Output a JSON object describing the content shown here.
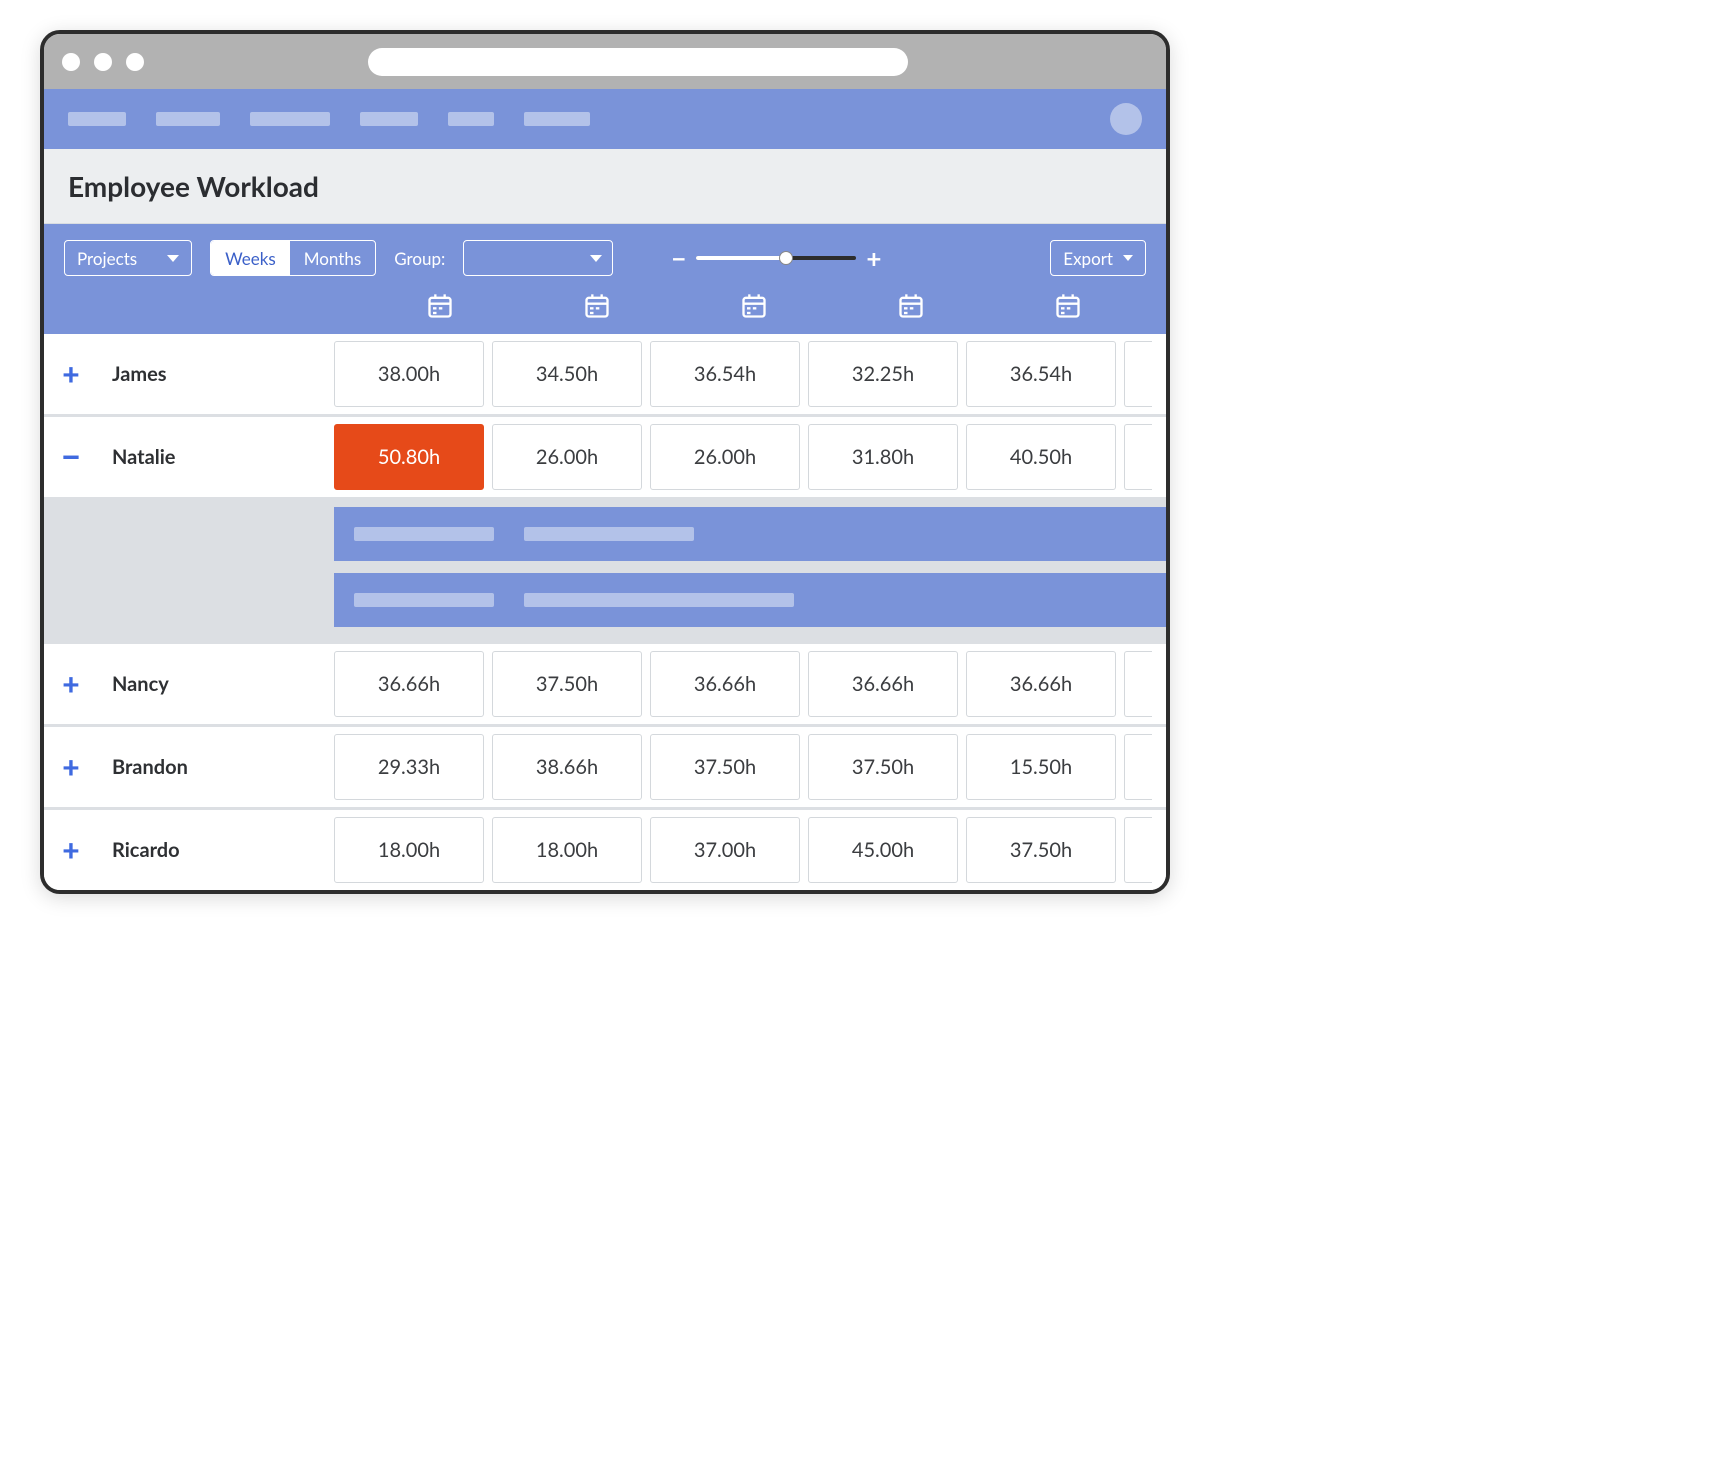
{
  "page": {
    "title": "Employee Workload"
  },
  "toolbar": {
    "filter_label": "Projects",
    "view_toggle": {
      "weeks": "Weeks",
      "months": "Months",
      "active": "weeks"
    },
    "group_label": "Group:",
    "export_label": "Export",
    "zoom": {
      "minus": "−",
      "plus": "+",
      "value_pct": 58
    }
  },
  "columns_count": 5,
  "employees": [
    {
      "name": "James",
      "expanded": false,
      "hours": [
        "38.00h",
        "34.50h",
        "36.54h",
        "32.25h",
        "36.54h"
      ]
    },
    {
      "name": "Natalie",
      "expanded": true,
      "hours": [
        "50.80h",
        "26.00h",
        "26.00h",
        "31.80h",
        "40.50h"
      ],
      "over_index": 0
    },
    {
      "name": "Nancy",
      "expanded": false,
      "hours": [
        "36.66h",
        "37.50h",
        "36.66h",
        "36.66h",
        "36.66h"
      ]
    },
    {
      "name": "Brandon",
      "expanded": false,
      "hours": [
        "29.33h",
        "38.66h",
        "37.50h",
        "37.50h",
        "15.50h"
      ]
    },
    {
      "name": "Ricardo",
      "expanded": false,
      "hours": [
        "18.00h",
        "18.00h",
        "37.00h",
        "45.00h",
        "37.50h"
      ]
    }
  ],
  "colors": {
    "accent": "#7a93d9",
    "accent_light": "#b3c2e9",
    "overload": "#e64a19",
    "link_blue": "#3f6ae0",
    "grid_bg": "#dcdfe3"
  }
}
